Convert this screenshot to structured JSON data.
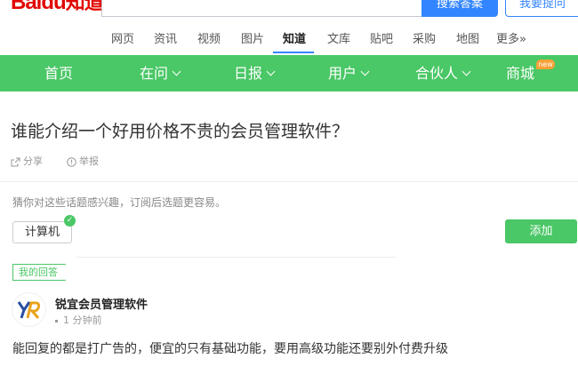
{
  "header": {
    "logo_bai": "Bai",
    "logo_du": "du",
    "logo_zhidao": "知道",
    "search_button": "搜索答案",
    "ask_button": "我要提问"
  },
  "channels": [
    {
      "label": "网页"
    },
    {
      "label": "资讯"
    },
    {
      "label": "视频"
    },
    {
      "label": "图片"
    },
    {
      "label": "知道",
      "active": true
    },
    {
      "label": "文库"
    },
    {
      "label": "贴吧"
    },
    {
      "label": "采购"
    },
    {
      "label": "地图"
    },
    {
      "label": "更多»"
    }
  ],
  "nav": {
    "items": [
      {
        "label": "首页"
      },
      {
        "label": "在问"
      },
      {
        "label": "日报"
      },
      {
        "label": "用户"
      },
      {
        "label": "合伙人"
      },
      {
        "label": "商城"
      }
    ],
    "badge": "new",
    "color": "#4ac766"
  },
  "question": {
    "title": "谁能介绍一个好用价格不贵的会员管理软件？",
    "share": "分享",
    "report": "举报"
  },
  "topics": {
    "hint": "猜你对这些话题感兴趣，订阅后选题更容易。",
    "tag": "计算机",
    "add_button": "添加"
  },
  "answer": {
    "my_answer_label": "我的回答",
    "user": "锐宜会员管理软件",
    "time": "1 分钟前",
    "text": "能回复的都是打广告的，便宜的只有基础功能，要用高级功能还要别外付费升级"
  }
}
